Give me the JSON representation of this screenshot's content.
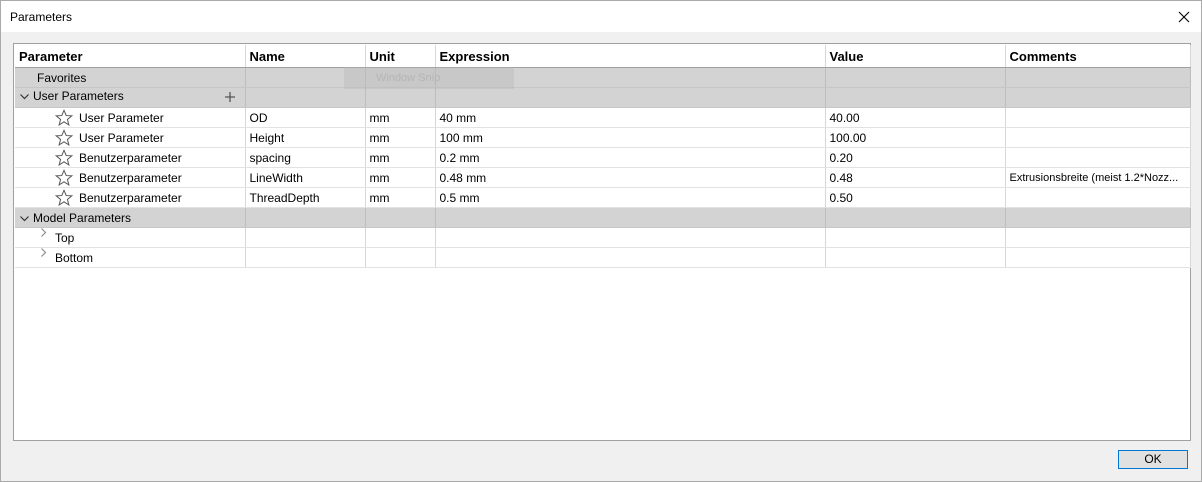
{
  "window": {
    "title": "Parameters"
  },
  "table": {
    "headers": [
      "Parameter",
      "Name",
      "Unit",
      "Expression",
      "Value",
      "Comments"
    ],
    "groups": {
      "favorites": "Favorites",
      "user": "User Parameters",
      "model": "Model Parameters"
    },
    "user_rows": [
      {
        "type": "User Parameter",
        "name": "OD",
        "unit": "mm",
        "expression": "40 mm",
        "value": "40.00",
        "comment": ""
      },
      {
        "type": "User Parameter",
        "name": "Height",
        "unit": "mm",
        "expression": "100 mm",
        "value": "100.00",
        "comment": ""
      },
      {
        "type": "Benutzerparameter",
        "name": "spacing",
        "unit": "mm",
        "expression": "0.2 mm",
        "value": "0.20",
        "comment": ""
      },
      {
        "type": "Benutzerparameter",
        "name": "LineWidth",
        "unit": "mm",
        "expression": "0.48 mm",
        "value": "0.48",
        "comment": "Extrusionsbreite (meist 1.2*Nozz..."
      },
      {
        "type": "Benutzerparameter",
        "name": "ThreadDepth",
        "unit": "mm",
        "expression": "0.5 mm",
        "value": "0.50",
        "comment": ""
      }
    ],
    "model_items": [
      "Top",
      "Bottom"
    ]
  },
  "overlay": {
    "snip_text": "Window Snip"
  },
  "footer": {
    "ok_label": "OK"
  },
  "icons": {
    "close": "close-icon",
    "star": "star-outline-icon",
    "expand": "chevron-down-icon",
    "collapsed": "chevron-right-icon",
    "add": "plus-icon"
  }
}
